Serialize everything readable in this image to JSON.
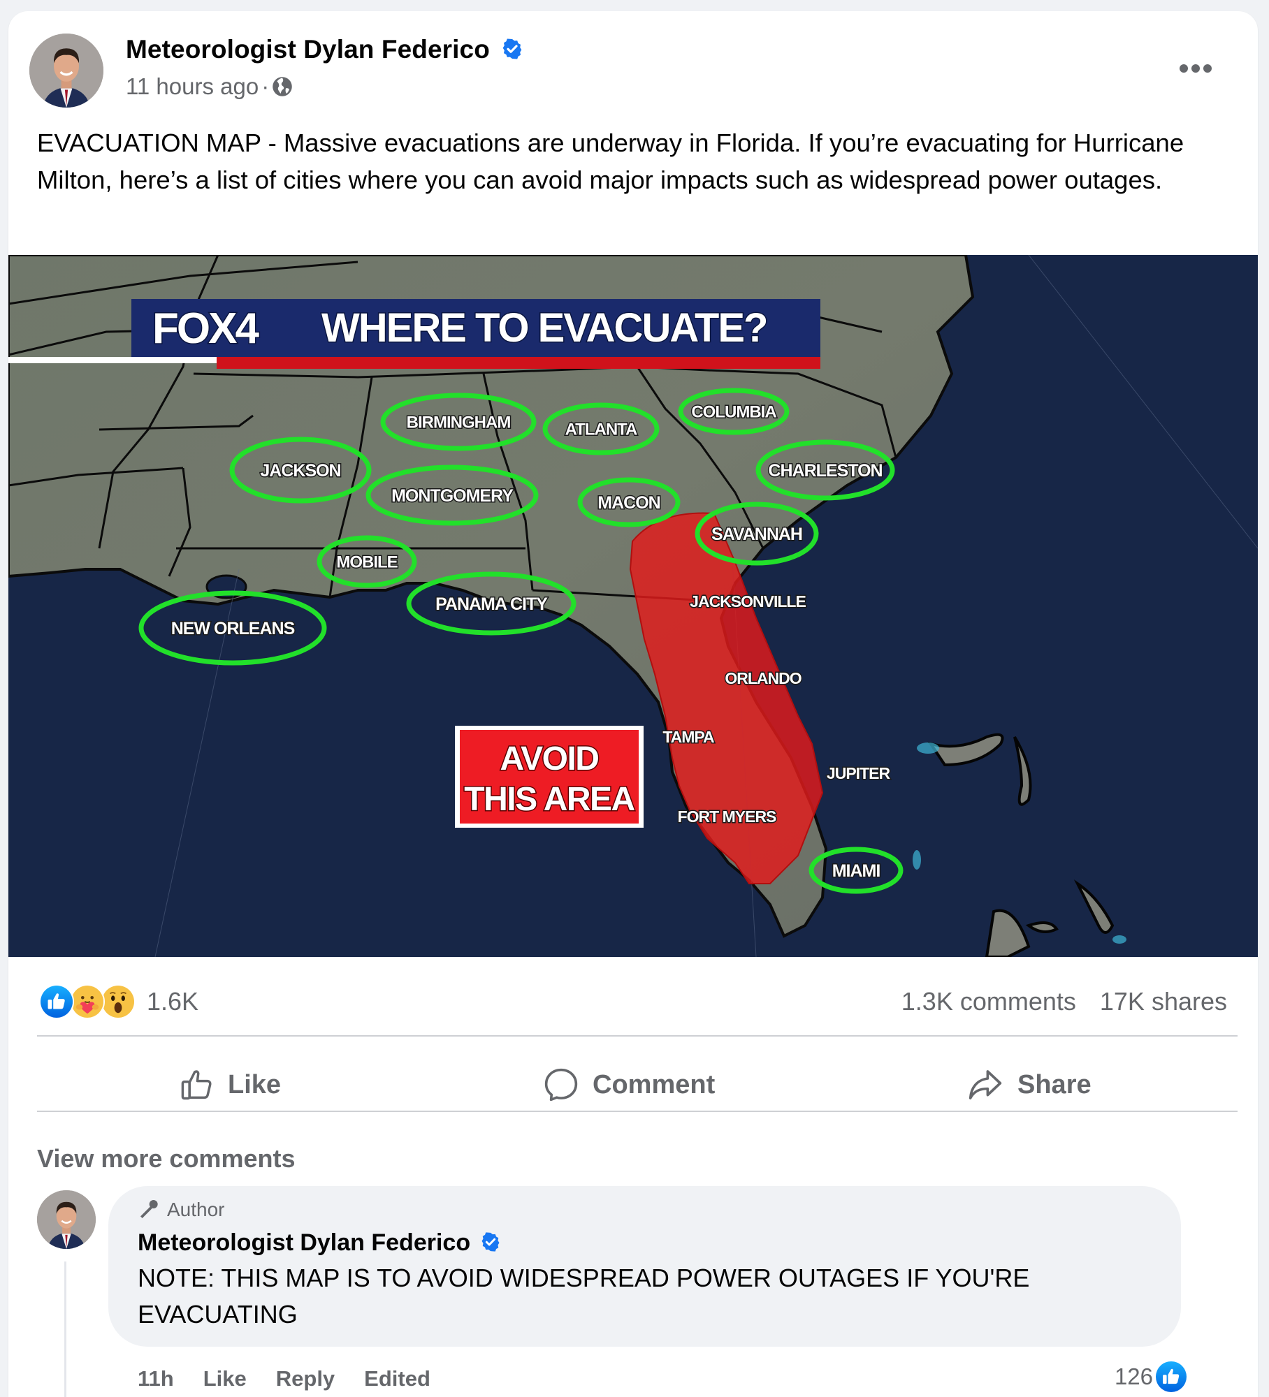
{
  "post": {
    "author": {
      "name": "Meteorologist Dylan Federico",
      "verified": true,
      "avatar_icon": "profile-photo"
    },
    "timestamp": "11 hours ago",
    "separator": "·",
    "audience_icon": "globe-icon",
    "more_icon": "more-options-icon",
    "text": "EVACUATION MAP - Massive evacuations are underway in Florida. If you’re evacuating for Hurricane Milton, here’s a list of cities where you can avoid major impacts such as widespread power outages."
  },
  "map_image": {
    "brand": "FOX4",
    "headline": "WHERE TO EVACUATE?",
    "avoid_box": [
      "AVOID",
      "THIS AREA"
    ],
    "safe_cities": [
      "BIRMINGHAM",
      "ATLANTA",
      "COLUMBIA",
      "JACKSON",
      "MONTGOMERY",
      "MACON",
      "CHARLESTON",
      "SAVANNAH",
      "MOBILE",
      "PANAMA CITY",
      "NEW ORLEANS",
      "MIAMI"
    ],
    "avoid_cities": [
      "JACKSONVILLE",
      "ORLANDO",
      "TAMPA",
      "JUPITER",
      "FORT MYERS"
    ],
    "colors": {
      "ocean": "#172647",
      "land": "#6d7367",
      "safe_ring": "#22e02a",
      "avoid_fill": "#e31b1b",
      "banner_blue": "#1a2a6c",
      "banner_red": "#d0121b"
    }
  },
  "stats": {
    "reactions": [
      "like",
      "care",
      "wow"
    ],
    "reaction_count": "1.6K",
    "comments": "1.3K comments",
    "shares": "17K shares"
  },
  "actions": {
    "like": "Like",
    "comment": "Comment",
    "share": "Share"
  },
  "comments_section": {
    "view_more": "View more comments",
    "comment": {
      "badge": "Author",
      "author": "Meteorologist Dylan Federico",
      "verified": true,
      "text": "NOTE: THIS MAP IS TO AVOID WIDESPREAD POWER OUTAGES IF YOU'RE EVACUATING",
      "time": "11h",
      "like": "Like",
      "reply": "Reply",
      "edited": "Edited",
      "like_count": "126"
    }
  },
  "colors": {
    "page_bg": "#f0f2f5",
    "card_bg": "#ffffff",
    "secondary_text": "#65676b",
    "brand_blue": "#1877f2"
  }
}
